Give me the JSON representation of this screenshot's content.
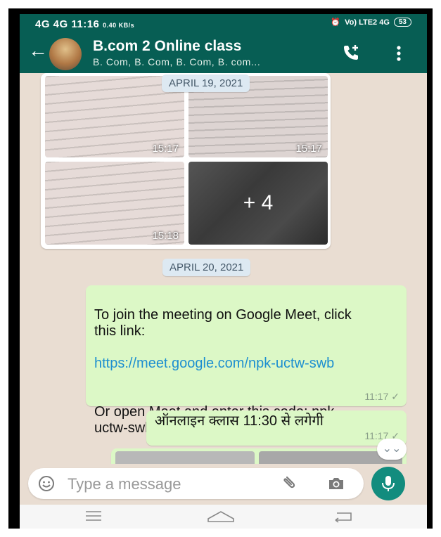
{
  "status_bar": {
    "network_left": "4G 4G",
    "time": "11:16",
    "speed": "0.40 KB/s",
    "network_right": "Vo) LTE2 4G",
    "battery": "53"
  },
  "header": {
    "title": "B.com 2 Online class",
    "subtitle": "B. Com, B. Com, B. Com, B. com..."
  },
  "chat": {
    "date_chip_1": "APRIL 19, 2021",
    "album": {
      "photos": [
        {
          "time": "15:17"
        },
        {
          "time": "15:17"
        },
        {
          "time": "15:18"
        }
      ],
      "more_label": "+ 4"
    },
    "date_chip_2": "APRIL 20, 2021",
    "messages": [
      {
        "text_1": "To join the meeting on Google Meet, click this link:",
        "link": "https://meet.google.com/npk-uctw-swb",
        "text_2": "Or open Meet and enter this code: npk-uctw-swb",
        "time": "11:17 ✓"
      },
      {
        "text": "ऑनलाइन क्लास 11:30 से लगेगी",
        "time": "11:17 ✓"
      }
    ],
    "scroll_down": "⌄⌄"
  },
  "input": {
    "placeholder": "Type a message"
  },
  "colors": {
    "header": "#075e54",
    "outgoing_bubble": "#dcf8c6",
    "mic_button": "#128c7e",
    "link": "#1d8fd0"
  }
}
